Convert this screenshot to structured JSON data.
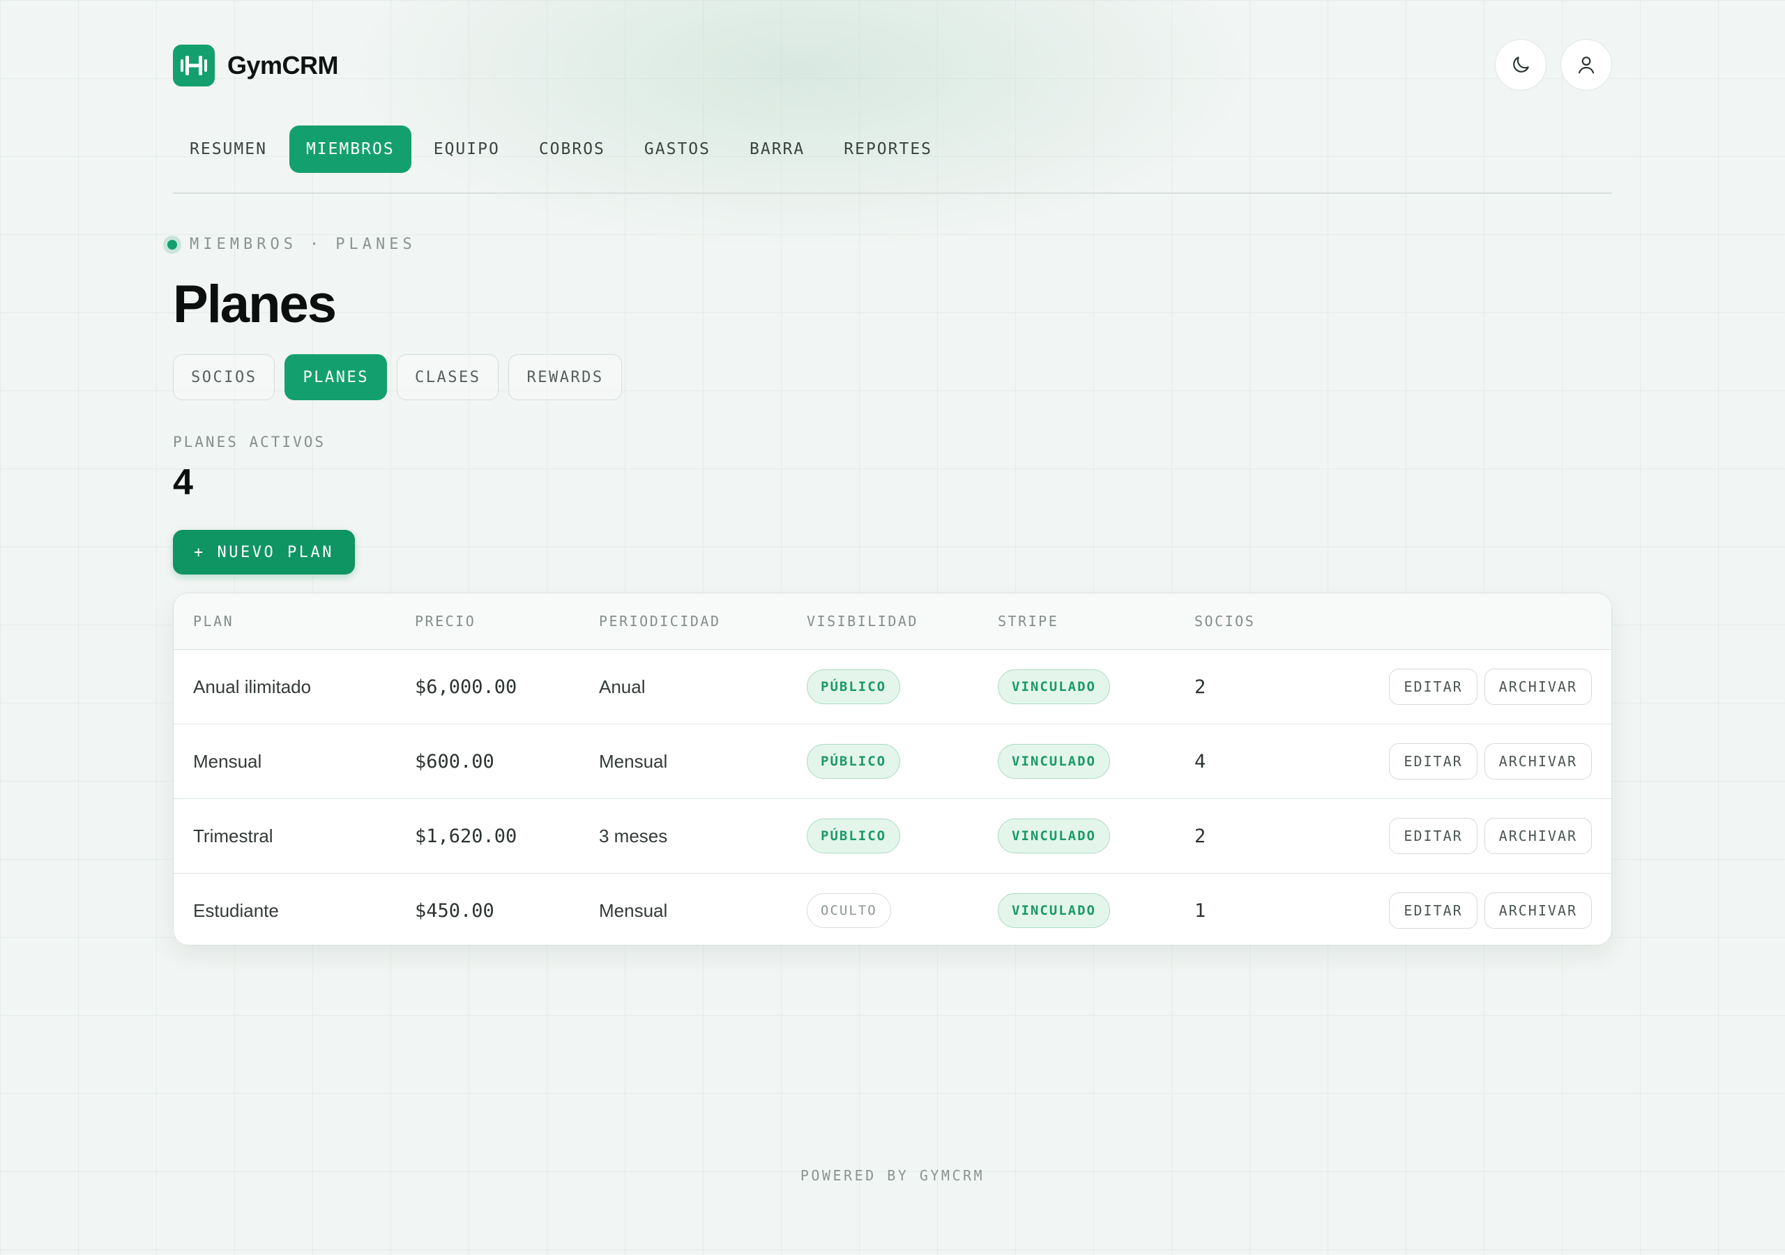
{
  "app": {
    "name": "GymCRM"
  },
  "nav": {
    "tabs": [
      {
        "label": "RESUMEN",
        "active": false
      },
      {
        "label": "MIEMBROS",
        "active": true
      },
      {
        "label": "EQUIPO",
        "active": false
      },
      {
        "label": "COBROS",
        "active": false
      },
      {
        "label": "GASTOS",
        "active": false
      },
      {
        "label": "BARRA",
        "active": false
      },
      {
        "label": "REPORTES",
        "active": false
      }
    ]
  },
  "header": {
    "theme_icon": "moon-icon",
    "profile_icon": "user-icon"
  },
  "breadcrumb": {
    "section": "MIEMBROS",
    "separator": "·",
    "page": "PLANES"
  },
  "page": {
    "title": "Planes"
  },
  "subtabs": [
    {
      "label": "SOCIOS",
      "active": false
    },
    {
      "label": "PLANES",
      "active": true
    },
    {
      "label": "CLASES",
      "active": false
    },
    {
      "label": "REWARDS",
      "active": false
    }
  ],
  "stat": {
    "label": "PLANES ACTIVOS",
    "value": "4"
  },
  "actions": {
    "new_plan": "+ NUEVO PLAN"
  },
  "table": {
    "headers": {
      "plan": "PLAN",
      "price": "PRECIO",
      "periodicity": "PERIODICIDAD",
      "visibility": "VISIBILIDAD",
      "stripe": "STRIPE",
      "members": "SOCIOS"
    },
    "rows": [
      {
        "plan": "Anual ilimitado",
        "price": "$6,000.00",
        "periodicity": "Anual",
        "visibility": "PÚBLICO",
        "stripe": "VINCULADO",
        "members": "2",
        "edit": "EDITAR",
        "archive": "ARCHIVAR"
      },
      {
        "plan": "Mensual",
        "price": "$600.00",
        "periodicity": "Mensual",
        "visibility": "PÚBLICO",
        "stripe": "VINCULADO",
        "members": "4",
        "edit": "EDITAR",
        "archive": "ARCHIVAR"
      },
      {
        "plan": "Trimestral",
        "price": "$1,620.00",
        "periodicity": "3 meses",
        "visibility": "PÚBLICO",
        "stripe": "VINCULADO",
        "members": "2",
        "edit": "EDITAR",
        "archive": "ARCHIVAR"
      },
      {
        "plan": "Estudiante",
        "price": "$450.00",
        "periodicity": "Mensual",
        "visibility": "OCULTO",
        "stripe": "VINCULADO",
        "members": "1",
        "edit": "EDITAR",
        "archive": "ARCHIVAR"
      }
    ]
  },
  "footer": {
    "text": "POWERED BY GYMCRM"
  },
  "colors": {
    "accent": "#14a06e",
    "accent_dark": "#0f9464",
    "badge_green_bg": "#e4f5ec",
    "badge_green_text": "#1a9a66"
  }
}
